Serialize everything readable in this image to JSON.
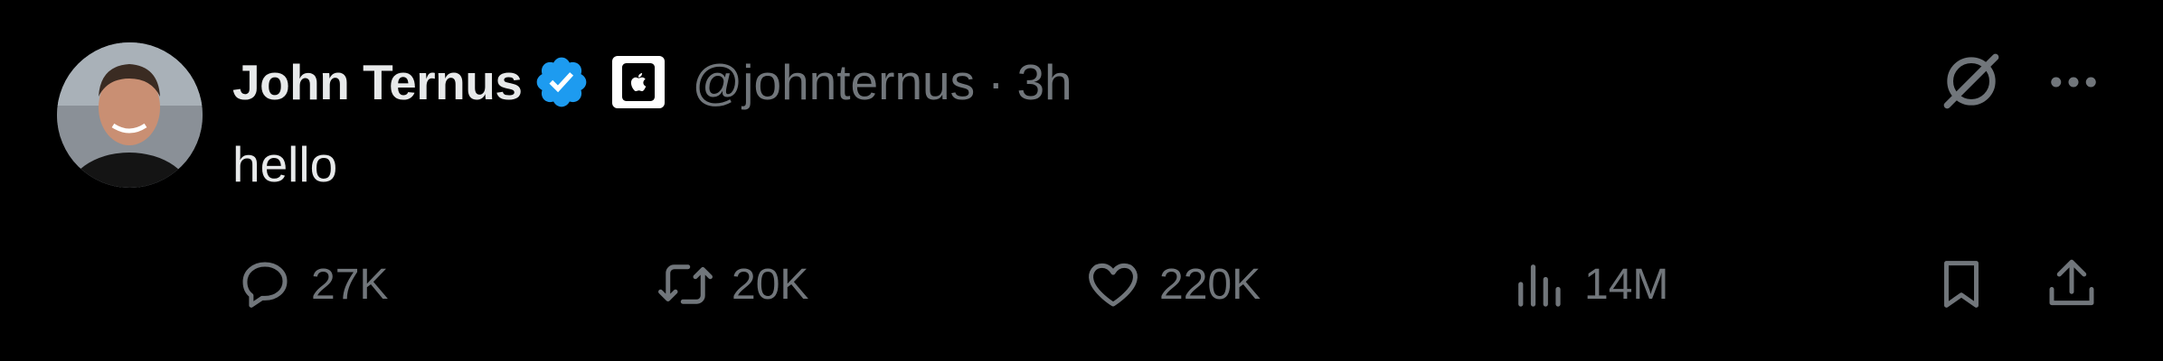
{
  "author": {
    "display_name": "John Ternus",
    "handle": "@johnternus",
    "separator": "·",
    "time": "3h",
    "verified": true,
    "affiliation_icon": "apple-logo-icon",
    "avatar_icon": "profile-photo"
  },
  "post": {
    "text": "hello"
  },
  "actions": {
    "replies": "27K",
    "reposts": "20K",
    "likes": "220K",
    "views": "14M"
  },
  "icons": {
    "reply": "reply-icon",
    "repost": "repost-icon",
    "like": "heart-icon",
    "views": "views-icon",
    "bookmark": "bookmark-icon",
    "share": "share-icon",
    "grok": "grok-icon",
    "more": "more-icon"
  },
  "colors": {
    "background": "#000000",
    "primary_text": "#e7e9ea",
    "secondary_text": "#71767b",
    "verified_blue": "#1d9bf0"
  }
}
